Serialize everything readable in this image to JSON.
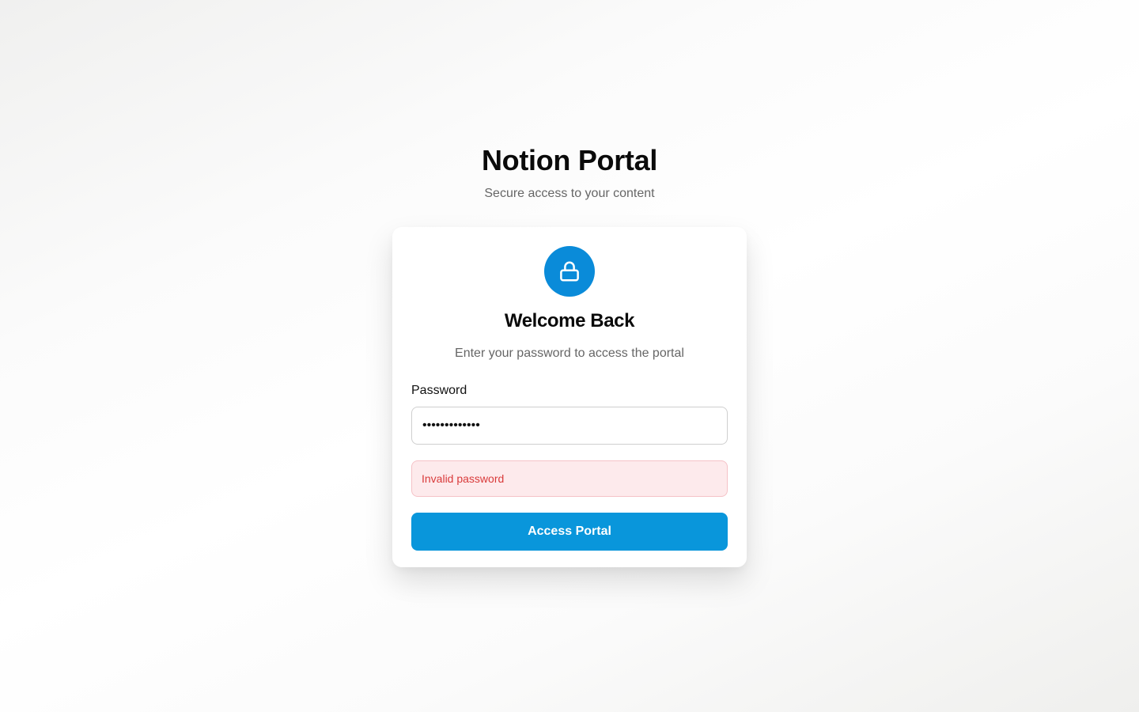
{
  "brand": {
    "title": "Notion Portal",
    "subtitle": "Secure access to your content"
  },
  "card": {
    "icon": "lock-icon",
    "title": "Welcome Back",
    "subtitle": "Enter your password to access the portal",
    "password_label": "Password",
    "password_value": "•••••••••••••",
    "error_message": "Invalid password",
    "submit_label": "Access Portal"
  },
  "colors": {
    "accent": "#0996db",
    "lock_circle": "#0a8bd9",
    "error_text": "#d93a3a",
    "error_background": "#fdeaec",
    "error_border": "#f5c2c7"
  }
}
